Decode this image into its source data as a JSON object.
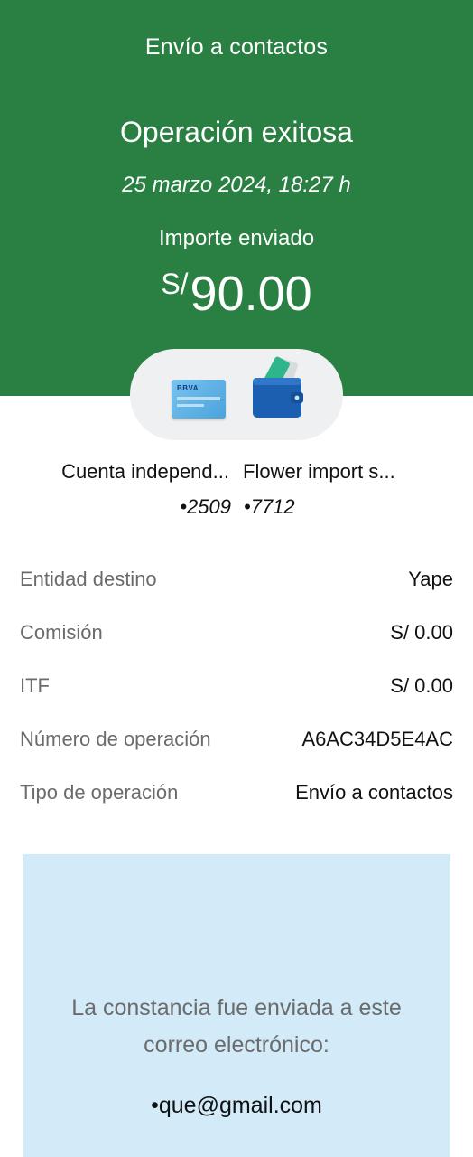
{
  "header": {
    "title": "Envío a contactos",
    "status": "Operación exitosa",
    "datetime": "25 marzo 2024,  18:27 h",
    "amount_label": "Importe enviado",
    "currency": "S/",
    "amount": "90.00",
    "background_color": "#2a7f43"
  },
  "icons": {
    "origin": "bank-card-icon",
    "destination": "wallet-icon",
    "card_brand": "BBVA"
  },
  "origin": {
    "name": "Cuenta independ...",
    "account": "•2509"
  },
  "destination": {
    "name": "Flower import s...",
    "account": "•7712"
  },
  "details": [
    {
      "label": "Entidad destino",
      "value": "Yape"
    },
    {
      "label": "Comisión",
      "value": "S/ 0.00"
    },
    {
      "label": "ITF",
      "value": "S/ 0.00"
    },
    {
      "label": "Número de operación",
      "value": "A6AC34D5E4AC"
    },
    {
      "label": "Tipo de operación",
      "value": "Envío a contactos"
    }
  ],
  "notice": {
    "message": "La constancia fue enviada a este correo electrónico:",
    "email": "•que@gmail.com",
    "background_color": "#d3ebf9"
  }
}
